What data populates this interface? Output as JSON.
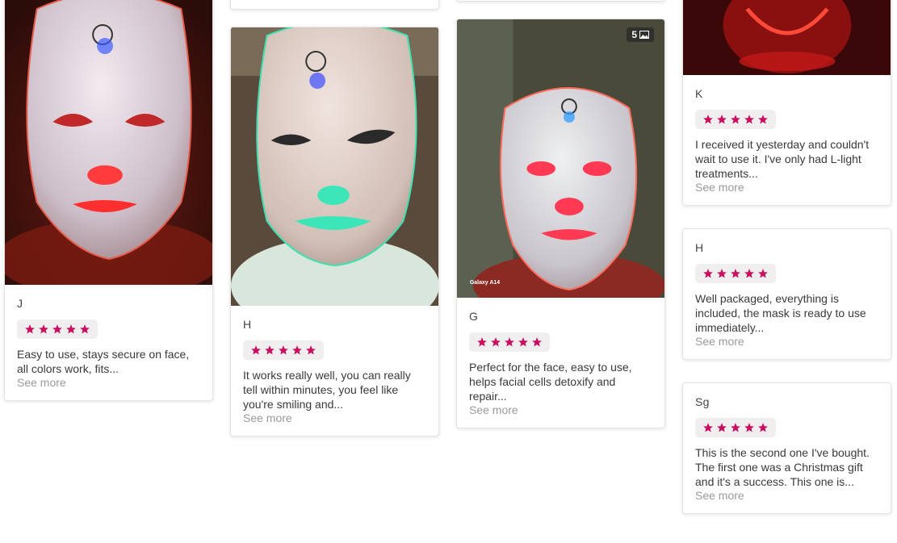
{
  "colors": {
    "star": "#c8105e",
    "star_bg": "#f1eeef",
    "see_more": "#9a9a9a"
  },
  "rating_icon": "star-icon",
  "cards": [
    {
      "author": "J",
      "text": "Easy to use, stays secure on face, all colors work, fits...",
      "see_more": "See more",
      "rating": 5
    },
    {
      "author": "H",
      "text": "It works really well, you can really tell within minutes, you feel like you're smiling and...",
      "see_more": "See more",
      "rating": 5
    },
    {
      "author": "G",
      "text": "Perfect for the face, easy to use, helps facial cells detoxify and repair...",
      "see_more": "See more",
      "rating": 5,
      "photo_count": "5",
      "watermark": "Galaxy A14"
    },
    {
      "author": "K",
      "text": "I received it yesterday and couldn't wait to use it. I've only had L-light treatments...",
      "see_more": "See more",
      "rating": 5
    },
    {
      "author": "H",
      "text": "Well packaged, everything is included, the mask is ready to use immediately...",
      "see_more": "See more",
      "rating": 5
    },
    {
      "author": "Sg",
      "text": "This is the second one I've bought. The first one was a Christmas gift and it's a success. This one is...",
      "see_more": "See more",
      "rating": 5
    }
  ]
}
